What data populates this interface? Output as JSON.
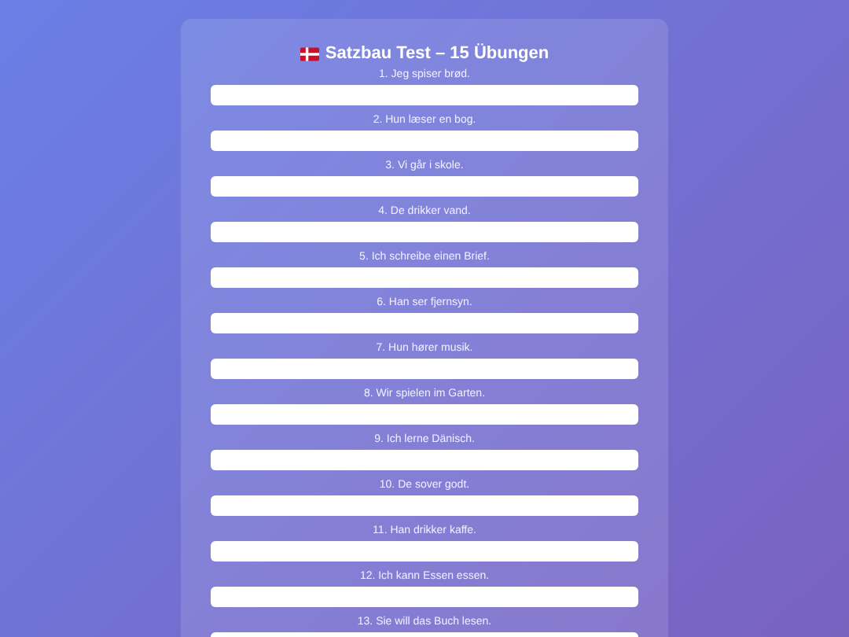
{
  "title": "Satzbau Test – 15 Übungen",
  "exercises": [
    {
      "prompt": "1. Jeg spiser brød."
    },
    {
      "prompt": "2. Hun læser en bog."
    },
    {
      "prompt": "3. Vi går i skole."
    },
    {
      "prompt": "4. De drikker vand."
    },
    {
      "prompt": "5. Ich schreibe einen Brief."
    },
    {
      "prompt": "6. Han ser fjernsyn."
    },
    {
      "prompt": "7. Hun hører musik."
    },
    {
      "prompt": "8. Wir spielen im Garten."
    },
    {
      "prompt": "9. Ich lerne Dänisch."
    },
    {
      "prompt": "10. De sover godt."
    },
    {
      "prompt": "11. Han drikker kaffe."
    },
    {
      "prompt": "12. Ich kann Essen essen."
    },
    {
      "prompt": "13. Sie will das Buch lesen."
    }
  ]
}
